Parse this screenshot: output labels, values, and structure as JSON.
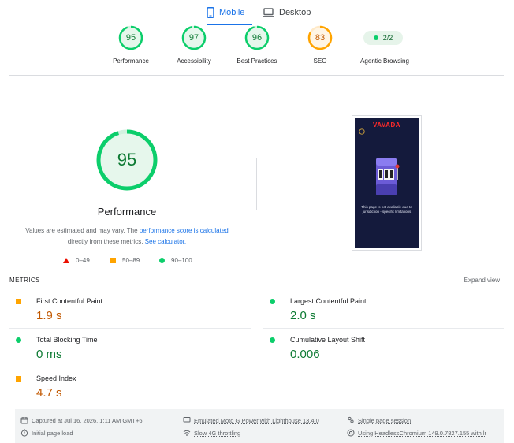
{
  "tabs": {
    "mobile": "Mobile",
    "desktop": "Desktop"
  },
  "scores": [
    {
      "key": "performance",
      "value": "95",
      "label": "Performance",
      "fill": 0.95,
      "color": "#0cce6b"
    },
    {
      "key": "accessibility",
      "value": "97",
      "label": "Accessibility",
      "fill": 0.97,
      "color": "#0cce6b"
    },
    {
      "key": "best_practices",
      "value": "96",
      "label": "Best Practices",
      "fill": 0.96,
      "color": "#0cce6b"
    },
    {
      "key": "seo",
      "value": "83",
      "label": "SEO",
      "fill": 0.83,
      "color": "#ffa400"
    }
  ],
  "agentic": {
    "value": "2/2",
    "label": "Agentic Browsing"
  },
  "main_gauge": {
    "value": "95",
    "fill": 0.95,
    "title": "Performance"
  },
  "note": {
    "text1": "Values are estimated and may vary. The ",
    "link1": "performance score is calculated",
    "text2": "directly from these metrics. ",
    "link2": "See calculator."
  },
  "legend": {
    "low": "0–49",
    "mid": "50–89",
    "high": "90–100"
  },
  "screenshot": {
    "brand": "VAVADA",
    "message": "This page is not available due to jurisdiction - specific limitations"
  },
  "metrics": {
    "title": "METRICS",
    "expand": "Expand view",
    "fcp": {
      "name": "First Contentful Paint",
      "value": "1.9 s"
    },
    "lcp": {
      "name": "Largest Contentful Paint",
      "value": "2.0 s"
    },
    "tbt": {
      "name": "Total Blocking Time",
      "value": "0 ms"
    },
    "cls": {
      "name": "Cumulative Layout Shift",
      "value": "0.006"
    },
    "si": {
      "name": "Speed Index",
      "value": "4.7 s"
    }
  },
  "footer": {
    "captured": "Captured at Jul 16, 2026, 1:11 AM GMT+6",
    "device": "Emulated Moto G Power with Lighthouse 13.4.0",
    "session": "Single page session",
    "initial_load": "Initial page load",
    "throttling": "Slow 4G throttling",
    "browser": "Using HeadlessChromium 149.0.7827.155 with lr"
  },
  "colors": {
    "accent": "#1a73e8",
    "pass": "#0cce6b",
    "average": "#ffa400",
    "fail": "#eb0f00"
  }
}
